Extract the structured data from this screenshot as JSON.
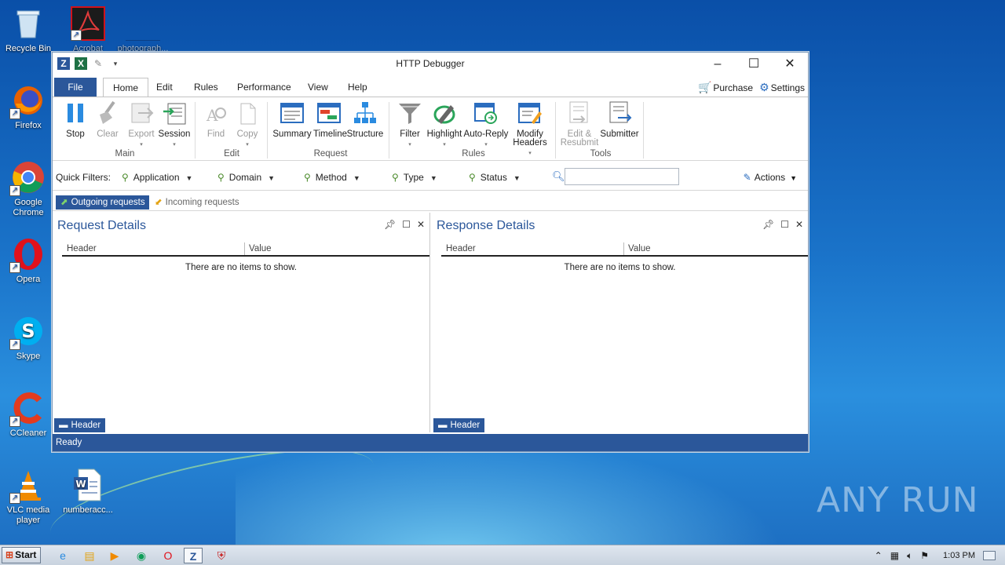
{
  "desktop": {
    "icons": [
      {
        "label": "Recycle Bin",
        "glyph": "🗑"
      },
      {
        "label": "Acrobat",
        "glyph": "A"
      },
      {
        "label": "photograph...",
        "glyph": ""
      },
      {
        "label": "Firefox",
        "glyph": "🦊"
      },
      {
        "label": "Google Chrome",
        "glyph": "◉"
      },
      {
        "label": "Opera",
        "glyph": "O"
      },
      {
        "label": "Skype",
        "glyph": "S"
      },
      {
        "label": "CCleaner",
        "glyph": "C"
      },
      {
        "label": "VLC media player",
        "glyph": "▲"
      },
      {
        "label": "numberacc...",
        "glyph": "W"
      }
    ],
    "watermark": "ANY RUN"
  },
  "window": {
    "title": "HTTP Debugger",
    "tabs": [
      "File",
      "Home",
      "Edit",
      "Rules",
      "Performance",
      "View",
      "Help"
    ],
    "purchase_label": "Purchase",
    "settings_label": "Settings",
    "ribbon": {
      "buttons": [
        {
          "label": "Stop",
          "icon": "pause-icon"
        },
        {
          "label": "Clear",
          "icon": "broom-icon"
        },
        {
          "label": "Export",
          "icon": "export-icon"
        },
        {
          "label": "Session",
          "icon": "session-icon"
        },
        {
          "label": "Find",
          "icon": "find-icon"
        },
        {
          "label": "Copy",
          "icon": "copy-icon"
        },
        {
          "label": "Summary",
          "icon": "summary-icon"
        },
        {
          "label": "Timeline",
          "icon": "timeline-icon"
        },
        {
          "label": "Structure",
          "icon": "structure-icon"
        },
        {
          "label": "Filter",
          "icon": "filter-icon"
        },
        {
          "label": "Highlight",
          "icon": "highlight-icon"
        },
        {
          "label": "Auto-Reply",
          "icon": "auto-reply-icon"
        },
        {
          "label": "Modify Headers",
          "icon": "modify-headers-icon"
        },
        {
          "label": "Edit & Resubmit",
          "icon": "edit-resubmit-icon"
        },
        {
          "label": "Submitter",
          "icon": "submitter-icon"
        }
      ],
      "groups": [
        "Main",
        "Edit",
        "Request",
        "Rules",
        "Tools"
      ]
    },
    "quick_filters": {
      "label": "Quick Filters:",
      "items": [
        "Application",
        "Domain",
        "Method",
        "Type",
        "Status"
      ],
      "search_value": "",
      "actions_label": "Actions"
    },
    "subtabs": [
      "Outgoing requests",
      "Incoming requests"
    ],
    "request_pane": {
      "title": "Request Details",
      "columns": [
        "Header",
        "Value"
      ],
      "empty_text": "There are no items to show.",
      "bottom_tab": "Header"
    },
    "response_pane": {
      "title": "Response Details",
      "columns": [
        "Header",
        "Value"
      ],
      "empty_text": "There are no items to show.",
      "bottom_tab": "Header"
    },
    "status": "Ready"
  },
  "taskbar": {
    "start_label": "Start",
    "clock": "1:03 PM"
  },
  "colors": {
    "accent": "#2b579a",
    "desktop": "#1a73c9"
  }
}
